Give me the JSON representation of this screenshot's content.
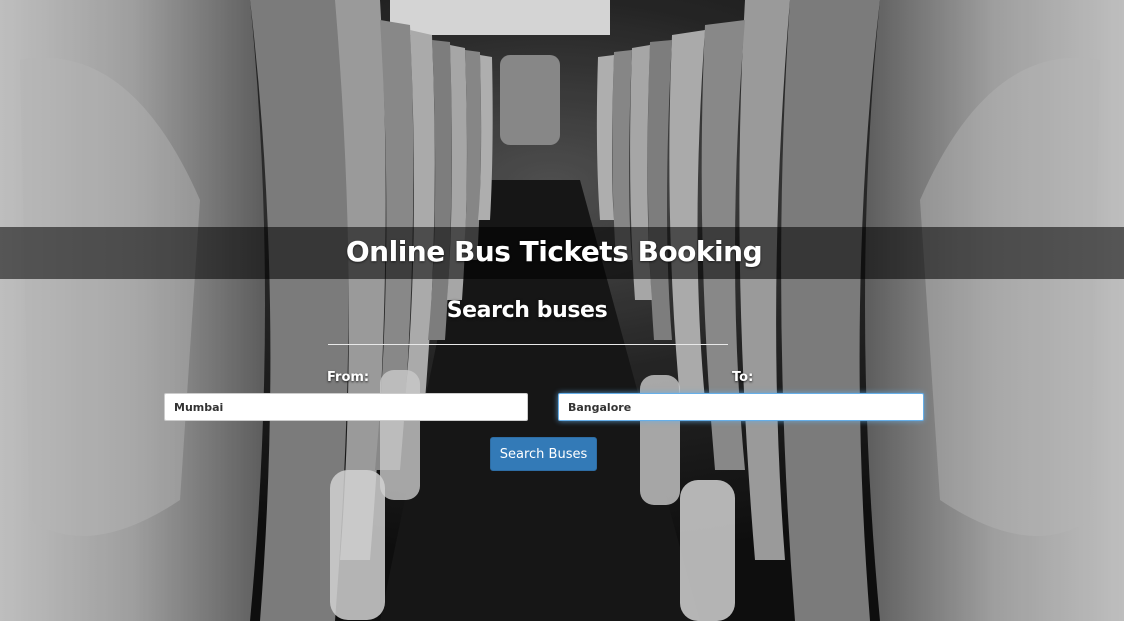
{
  "header": {
    "title": "Online Bus Tickets Booking"
  },
  "search": {
    "heading": "Search buses",
    "from_label": "From:",
    "from_value": "Mumbai",
    "to_label": "To:",
    "to_value": "Bangalore",
    "submit_label": "Search Buses"
  },
  "colors": {
    "button": "#337ab7",
    "focus_ring": "#66afe9"
  }
}
